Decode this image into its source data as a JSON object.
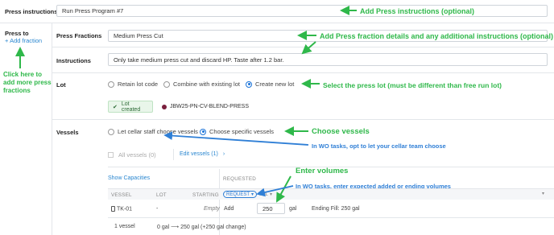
{
  "press_instructions": {
    "label": "Press instructions",
    "value": "Run Press Program #7",
    "annotation": "Add Press instructions (optional)"
  },
  "sidebar": {
    "press_to_label": "Press to",
    "add_fraction_label": "Add fraction",
    "annotation": "Click here to add more press fractions"
  },
  "fractions": {
    "label": "Press Fractions",
    "value": "Medium Press Cut",
    "annotation": "Add Press fraction details and any additional instructions (optional)"
  },
  "instructions": {
    "label": "Instructions",
    "value": "Only take medium press cut and discard HP. Taste after 1.2 bar."
  },
  "lot": {
    "label": "Lot",
    "options": [
      {
        "label": "Retain lot code",
        "selected": false
      },
      {
        "label": "Combine with existing lot",
        "selected": false
      },
      {
        "label": "Create new lot",
        "selected": true
      }
    ],
    "annotation": "Select the press lot (must be different than free run lot)",
    "created_badge": "Lot created",
    "created_code": "JBW25-PN-CV-BLEND-PRESS"
  },
  "vessels": {
    "label": "Vessels",
    "options": [
      {
        "label": "Let cellar staff choose vessels",
        "selected": false
      },
      {
        "label": "Choose specific vessels",
        "selected": true
      }
    ],
    "annotation_choose": "Choose vessels",
    "annotation_wo": "In WO tasks, opt to let your cellar team choose",
    "all_vessels_label": "All vessels (0)",
    "edit_vessels_label": "Edit vessels (1)"
  },
  "volumes": {
    "annotation_enter": "Enter volumes",
    "annotation_wo": "In WO tasks, enter expected added or ending volumes",
    "show_capacities": "Show Capacities",
    "requested_header": "REQUESTED",
    "columns": {
      "vessel": "VESSEL",
      "lot": "LOT",
      "starting": "STARTING",
      "request": "REQUEST",
      "vol": "VOL"
    },
    "row": {
      "vessel": "TK-01",
      "lot": "-",
      "starting": "Empty",
      "mode": "Add",
      "value": "250",
      "unit": "gal",
      "ending": "Ending Fill: 250 gal"
    },
    "footer_count": "1 vessel",
    "footer_change": "0 gal ⟶ 250 gal (+250 gal change)"
  },
  "colors": {
    "annotation_green": "#2fb84a",
    "annotation_blue": "#2f7fd6",
    "accent": "#1a73d8"
  }
}
